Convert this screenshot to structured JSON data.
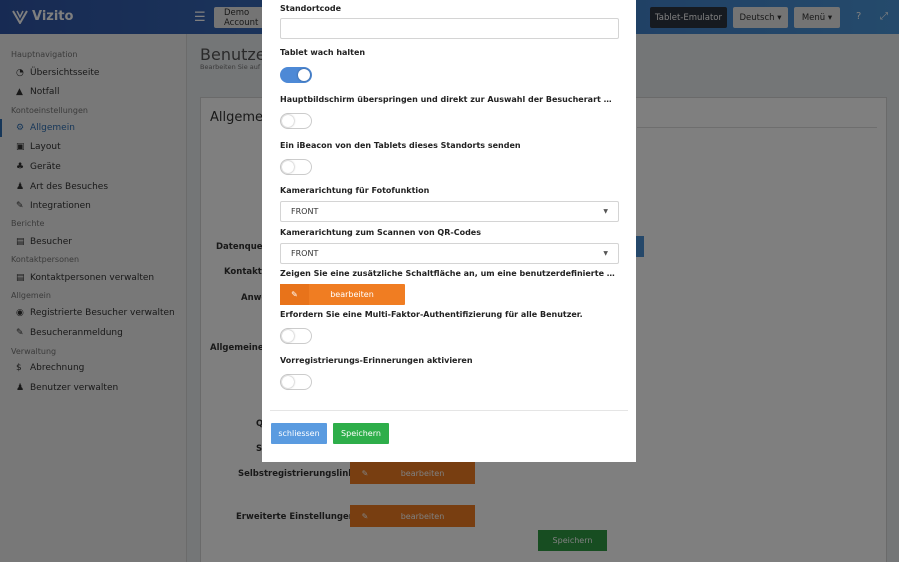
{
  "app": {
    "name": "Vizito",
    "brand_color": "#2f55a6"
  },
  "topbar": {
    "account_button": "Demo Account",
    "emulator_button": "Tablet-Emulator",
    "language_button": "Deutsch ▾",
    "menu_button": "Menü ▾",
    "help_icon": "?",
    "expand_icon": "⤢"
  },
  "sidebar": {
    "sections": [
      {
        "label": "Hauptnavigation"
      },
      {
        "label": "Kontoeinstellungen"
      },
      {
        "label": "Berichte"
      },
      {
        "label": "Kontaktpersonen"
      },
      {
        "label": "Allgemein"
      },
      {
        "label": "Verwaltung"
      }
    ],
    "items": [
      {
        "label": "Übersichtsseite",
        "icon": "◔"
      },
      {
        "label": "Notfall",
        "icon": "▲"
      },
      {
        "label": "Allgemein",
        "icon": "⚙"
      },
      {
        "label": "Layout",
        "icon": "▣"
      },
      {
        "label": "Geräte",
        "icon": "♣"
      },
      {
        "label": "Art des Besuches",
        "icon": "♟"
      },
      {
        "label": "Integrationen",
        "icon": "✎"
      },
      {
        "label": "Besucher",
        "icon": "▤"
      },
      {
        "label": "Kontaktpersonen verwalten",
        "icon": "▤"
      },
      {
        "label": "Registrierte Besucher verwalten",
        "icon": "◉"
      },
      {
        "label": "Besucheranmeldung",
        "icon": "✎"
      },
      {
        "label": "Abrechnung",
        "icon": "$"
      },
      {
        "label": "Benutzer verwalten",
        "icon": "♟"
      }
    ]
  },
  "background": {
    "page_title": "Benutzerk",
    "page_subtitle": "Bearbeiten Sie auf d",
    "card_title": "Allgemein",
    "labels": {
      "datenquelle": "Datenquelle",
      "kontaktpe": "Kontaktpe",
      "anwe": "Anwe",
      "allgemeine_ap": "Allgemeine Ap",
      "q": "Q",
      "st": "St",
      "selbst": "Selbstregistrierungslink",
      "erweitert": "Erweiterte Einstellungen"
    },
    "edit_label": "bearbeiten",
    "save_label": "Speichern"
  },
  "modal": {
    "standortcode_label": "Standortcode",
    "standortcode_value": "",
    "tablet_wach_label": "Tablet wach halten",
    "tablet_wach_on": true,
    "skip_home_label": "Hauptbildschirm überspringen und direkt zur Auswahl der Besucherart wechseln",
    "skip_home_on": false,
    "ibeacon_label": "Ein iBeacon von den Tablets dieses Standorts senden",
    "ibeacon_on": false,
    "camera_photo_label": "Kamerarichtung für Fotofunktion",
    "camera_photo_value": "FRONT",
    "camera_qr_label": "Kamerarichtung zum Scannen von QR-Codes",
    "camera_qr_value": "FRONT",
    "extra_button_label": "Zeigen Sie eine zusätzliche Schaltfläche an, um eine benutzerdefinierte Benachrichtigung zu senden",
    "edit_button": "bearbeiten",
    "mfa_label": "Erfordern Sie eine Multi-Faktor-Authentifizierung für alle Benutzer.",
    "mfa_on": false,
    "prereg_label": "Vorregistrierungs-Erinnerungen aktivieren",
    "prereg_on": false,
    "close_button": "schliessen",
    "save_button": "Speichern"
  }
}
